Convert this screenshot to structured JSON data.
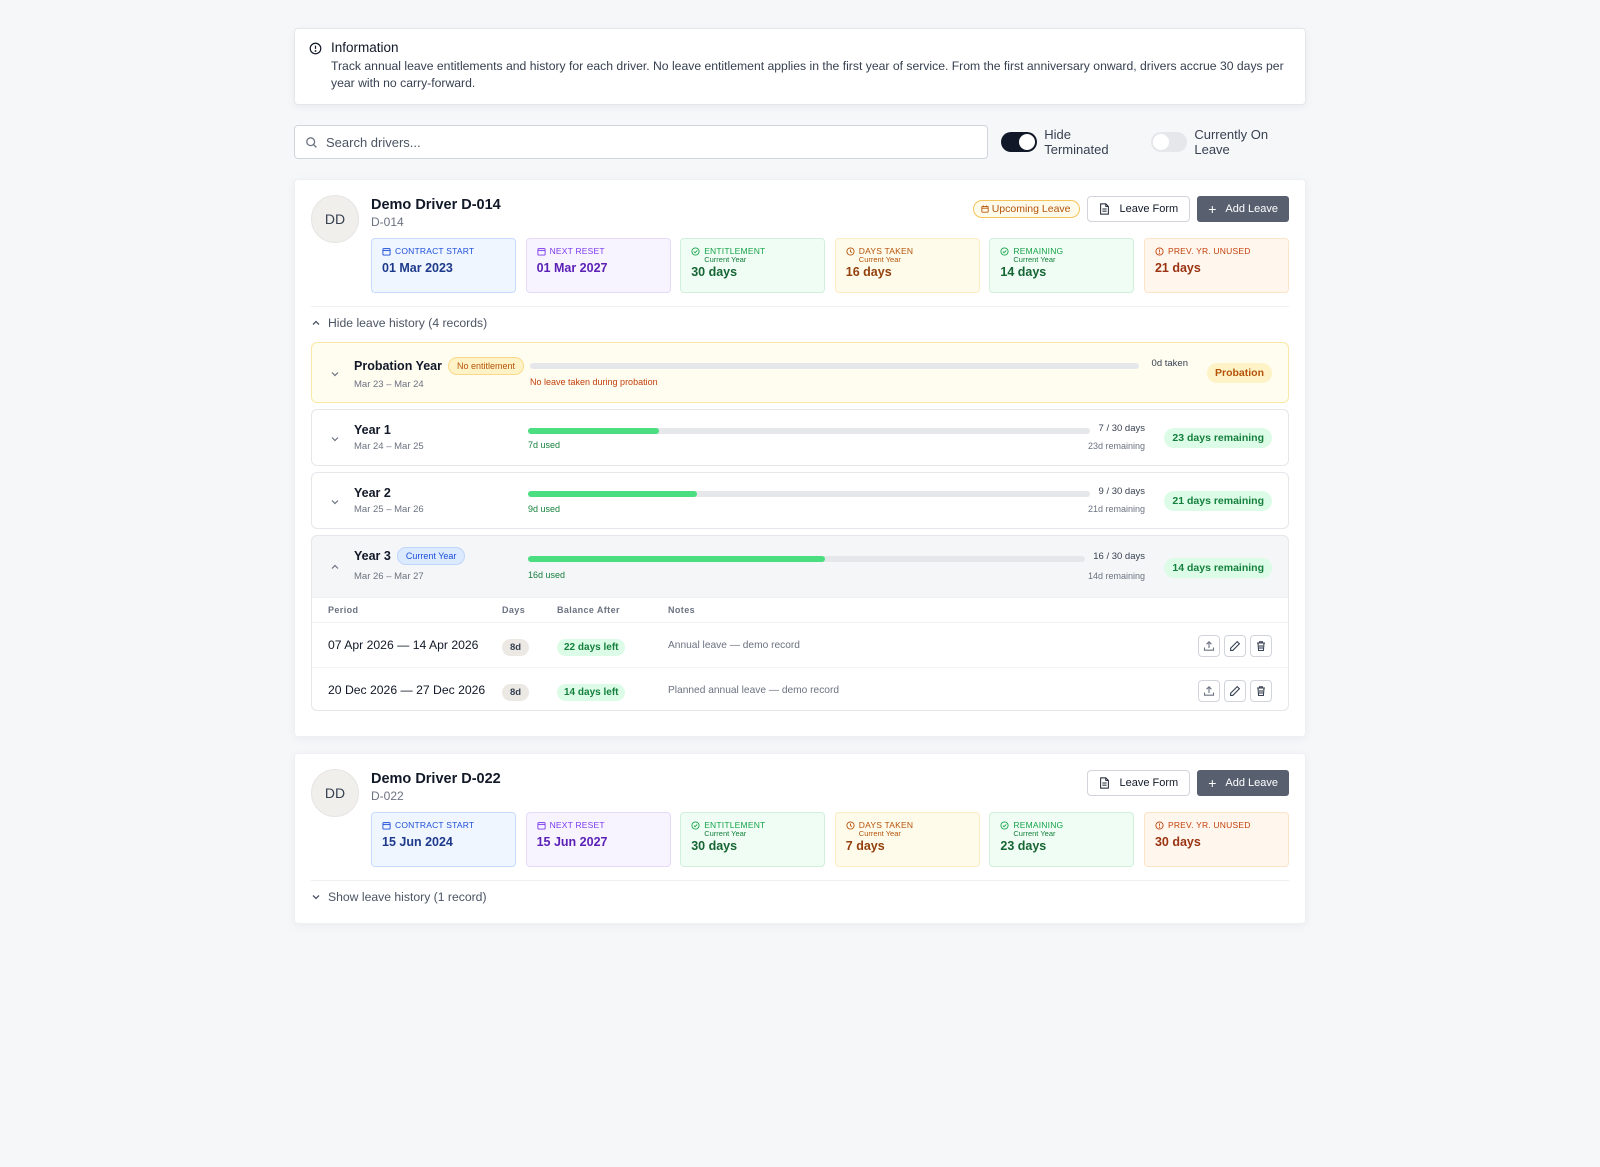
{
  "info": {
    "title": "Information",
    "text": "Track annual leave entitlements and history for each driver. No leave entitlement applies in the first year of service. From the first anniversary onward, drivers accrue 30 days per year with no carry-forward."
  },
  "search": {
    "placeholder": "Search drivers...",
    "value": ""
  },
  "toggles": {
    "hide_terminated": {
      "label": "Hide Terminated",
      "on": true
    },
    "currently_on_leave": {
      "label": "Currently On Leave",
      "on": false
    }
  },
  "buttons": {
    "leave_form": "Leave Form",
    "add_leave": "Add Leave"
  },
  "labels": {
    "contract_start": "Contract Start",
    "next_reset": "Next Reset",
    "entitlement": "Entitlement",
    "days_taken": "Days Taken",
    "remaining": "Remaining",
    "prev_unused": "Prev. Yr. Unused",
    "current_year_sub": "Current Year"
  },
  "drivers": [
    {
      "initials": "DD",
      "name": "Demo Driver D-014",
      "id": "D-014",
      "upcoming_badge": "Upcoming Leave",
      "stats": {
        "contract_start": "01 Mar 2023",
        "next_reset": "01 Mar 2027",
        "entitlement": "30 days",
        "days_taken": "16 days",
        "remaining": "14 days",
        "prev_unused": "21 days"
      },
      "history_toggle": "Hide leave history (4 records)",
      "years": [
        {
          "title": "Probation Year",
          "badge": "No entitlement",
          "range": "Mar 23 – Mar 24",
          "top_right": "0d taken",
          "bottom_left": "No leave taken during probation",
          "status": "Probation",
          "progress": 0
        },
        {
          "title": "Year 1",
          "range": "Mar 24 – Mar 25",
          "top_right": "7 / 30 days",
          "bottom_left": "7d used",
          "bottom_right": "23d remaining",
          "status": "23 days remaining",
          "progress": 0.2333
        },
        {
          "title": "Year 2",
          "range": "Mar 25 – Mar 26",
          "top_right": "9 / 30 days",
          "bottom_left": "9d used",
          "bottom_right": "21d remaining",
          "status": "21 days remaining",
          "progress": 0.3
        },
        {
          "title": "Year 3",
          "badge": "Current Year",
          "range": "Mar 26 – Mar 27",
          "top_right": "16 / 30 days",
          "bottom_left": "16d used",
          "bottom_right": "14d remaining",
          "status": "14 days remaining",
          "progress": 0.5333
        }
      ],
      "table": {
        "headers": [
          "Period",
          "Days",
          "Balance After",
          "Notes"
        ],
        "rows": [
          {
            "period": "07 Apr 2026 — 14 Apr 2026",
            "days": "8d",
            "balance": "22 days left",
            "notes": "Annual leave — demo record"
          },
          {
            "period": "20 Dec 2026 — 27 Dec 2026",
            "days": "8d",
            "balance": "14 days left",
            "notes": "Planned annual leave — demo record"
          }
        ]
      }
    },
    {
      "initials": "DD",
      "name": "Demo Driver D-022",
      "id": "D-022",
      "stats": {
        "contract_start": "15 Jun 2024",
        "next_reset": "15 Jun 2027",
        "entitlement": "30 days",
        "days_taken": "7 days",
        "remaining": "23 days",
        "prev_unused": "30 days"
      },
      "history_toggle": "Show leave history (1 record)"
    }
  ],
  "icons": {
    "info": "info-circle-icon",
    "search": "search-icon",
    "calendar": "calendar-icon",
    "check": "check-circle-icon",
    "clock": "clock-icon",
    "alert": "alert-circle-icon",
    "document": "document-icon",
    "chevron_up": "chevron-up-icon",
    "chevron_down": "chevron-down-icon",
    "upload": "upload-icon",
    "edit": "pencil-icon",
    "delete": "trash-icon"
  }
}
